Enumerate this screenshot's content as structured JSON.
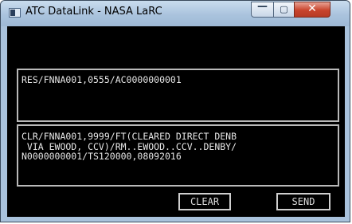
{
  "window": {
    "title": "ATC DataLink - NASA LaRC",
    "controls": {
      "minimize": "—",
      "maximize": "▢",
      "close": "✕"
    }
  },
  "response_panel": {
    "text": "RES/FNNA001,0555/AC0000000001"
  },
  "clearance_panel": {
    "lines": [
      "CLR/FNNA001,9999/FT(CLEARED DIRECT DENB",
      " VIA EWOOD, CCV)/RM..EWOOD..CCV..DENBY/",
      "N0000000001/TS120000,08092016"
    ]
  },
  "buttons": {
    "clear": "CLEAR",
    "send": "SEND"
  }
}
